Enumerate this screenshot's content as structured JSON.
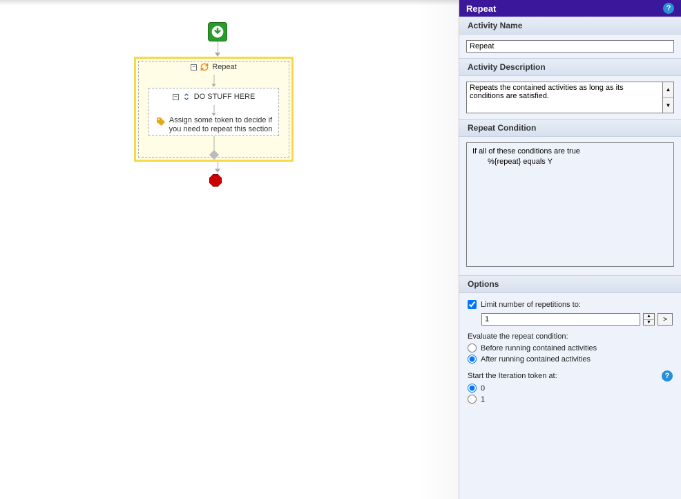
{
  "panel_title": "Repeat",
  "sections": {
    "activity_name": "Activity Name",
    "activity_description": "Activity Description",
    "repeat_condition": "Repeat Condition",
    "options": "Options"
  },
  "activity_name_value": "Repeat",
  "activity_description_value": "Repeats the contained activities as long as its conditions are satisfied.",
  "condition": {
    "header": "If all of these conditions are true",
    "rule": "%{repeat} equals Y"
  },
  "options": {
    "limit_label": "Limit number of repetitions to:",
    "limit_checked": true,
    "limit_value": "1",
    "eval_label": "Evaluate the repeat condition:",
    "eval_before": "Before running contained activities",
    "eval_after": "After running contained activities",
    "eval_selected": "after",
    "iter_label": "Start the Iteration token at:",
    "iter_0": "0",
    "iter_1": "1",
    "iter_selected": "0"
  },
  "diagram": {
    "repeat_label": "Repeat",
    "inner_label": "DO STUFF HERE",
    "assign_line1": "Assign some token to decide if",
    "assign_line2": "you need to repeat this section"
  }
}
